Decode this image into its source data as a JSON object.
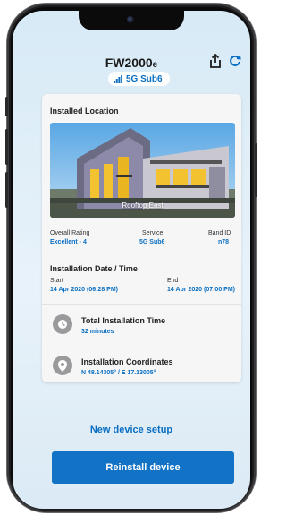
{
  "header": {
    "model_main": "FW2000",
    "model_suffix": "e",
    "band_badge": "5G Sub6"
  },
  "installed_location": {
    "section_title": "Installed Location",
    "image_caption": "Rooftop East",
    "stats": [
      {
        "label": "Overall Rating",
        "value": "Excellent - 4"
      },
      {
        "label": "Service",
        "value": "5G Sub6"
      },
      {
        "label": "Band ID",
        "value": "n78"
      }
    ]
  },
  "installation_datetime": {
    "section_title": "Installation Date / Time",
    "start_label": "Start",
    "start_value": "14 Apr 2020 (06:28 PM)",
    "end_label": "End",
    "end_value": "14 Apr 2020 (07:00 PM)"
  },
  "total_time": {
    "title": "Total Installation Time",
    "value": "32 minutes"
  },
  "coordinates": {
    "title": "Installation Coordinates",
    "value": "N 48.14305° / E 17.13005°"
  },
  "actions": {
    "new_setup_label": "New device setup",
    "reinstall_label": "Reinstall device"
  },
  "colors": {
    "accent": "#0a6fc2",
    "button": "#1172c6",
    "background": "#dbeaf5"
  },
  "icons": [
    "share-icon",
    "refresh-icon",
    "signal-bars-icon",
    "clock-icon",
    "location-pin-icon"
  ]
}
